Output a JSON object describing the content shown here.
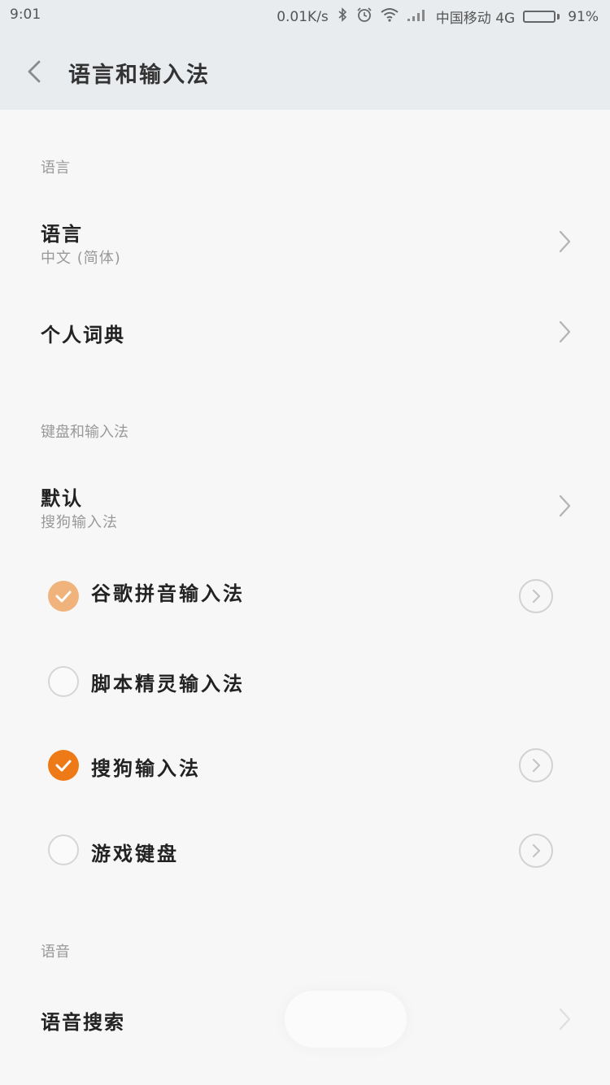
{
  "status_bar": {
    "time": "9:01",
    "network_speed": "0.01K/s",
    "carrier": "中国移动 4G",
    "battery_percent": 91,
    "battery_label": "91%"
  },
  "header": {
    "title": "语言和输入法"
  },
  "sections": {
    "language": {
      "header": "语言",
      "language_item": {
        "label": "语言",
        "value": "中文 (简体)"
      },
      "dictionary_item": {
        "label": "个人词典"
      }
    },
    "keyboard": {
      "header": "键盘和输入法",
      "default_item": {
        "label": "默认",
        "value": "搜狗输入法"
      },
      "ime_list": [
        {
          "label": "谷歌拼音输入法",
          "checked": true,
          "has_settings": true
        },
        {
          "label": "脚本精灵输入法",
          "checked": false,
          "has_settings": false
        },
        {
          "label": "搜狗输入法",
          "checked": true,
          "has_settings": true
        },
        {
          "label": "游戏键盘",
          "checked": false,
          "has_settings": true
        }
      ]
    },
    "voice": {
      "header": "语音",
      "voice_search_item": {
        "label": "语音搜索"
      }
    }
  },
  "colors": {
    "accent": "#ee7a17",
    "header_bg": "#e9ecef",
    "page_bg": "#f7f7f7"
  }
}
